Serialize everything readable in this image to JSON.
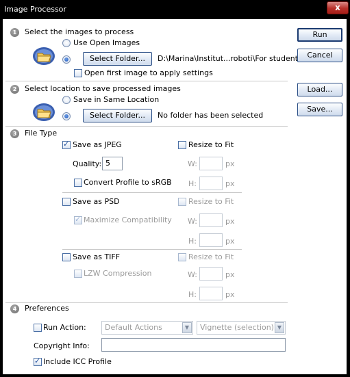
{
  "window": {
    "title": "Image Processor",
    "close_glyph": "x"
  },
  "step1": {
    "number": "1",
    "heading": "Select the images to process",
    "use_open_images": "Use Open Images",
    "select_folder": "Select Folder...",
    "path": "D:\\Marina\\Institut...roboti\\For student",
    "open_first_image": "Open first image to apply settings"
  },
  "step2": {
    "number": "2",
    "heading": "Select location to save processed images",
    "save_same_location": "Save in Same Location",
    "select_folder": "Select Folder...",
    "no_folder": "No folder has been selected"
  },
  "step3": {
    "number": "3",
    "heading": "File Type",
    "jpeg": {
      "save_as": "Save as JPEG",
      "quality_label": "Quality:",
      "quality_value": "5",
      "convert_profile": "Convert Profile to sRGB",
      "resize": "Resize to Fit",
      "w_label": "W:",
      "h_label": "H:",
      "px": "px"
    },
    "psd": {
      "save_as": "Save as PSD",
      "maximize": "Maximize Compatibility",
      "resize": "Resize to Fit",
      "w_label": "W:",
      "h_label": "H:",
      "px": "px"
    },
    "tiff": {
      "save_as": "Save as TIFF",
      "lzw": "LZW Compression",
      "resize": "Resize to Fit",
      "w_label": "W:",
      "h_label": "H:",
      "px": "px"
    }
  },
  "step4": {
    "number": "4",
    "heading": "Preferences",
    "run_action": "Run Action:",
    "action_set": "Default Actions",
    "action": "Vignette (selection)",
    "copyright_label": "Copyright Info:",
    "copyright_value": "",
    "include_icc": "Include ICC Profile"
  },
  "buttons": {
    "run": "Run",
    "cancel": "Cancel",
    "load": "Load...",
    "save": "Save..."
  },
  "icons": {
    "step": "numbered-circle-icon",
    "folder": "bridge-folder-icon",
    "dropdown": "chevron-down-icon"
  },
  "colors": {
    "title_bar": "#000000",
    "close_button": "#b8302a",
    "accent": "#1f56b8"
  }
}
